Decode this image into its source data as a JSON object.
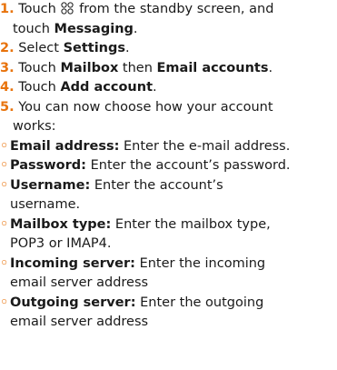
{
  "colors": {
    "accent": "#e8730c",
    "text": "#1a1a1a"
  },
  "steps": [
    {
      "num": "1.",
      "pre": "Touch",
      "icon": "apps-grid-icon",
      "mid": "from the standby screen, and",
      "line2_pre": "touch",
      "line2_bold": "Messaging",
      "line2_post": "."
    },
    {
      "num": "2.",
      "pre": "Select",
      "bold": "Settings",
      "post": "."
    },
    {
      "num": "3.",
      "pre": "Touch",
      "bold": "Mailbox",
      "mid": "then",
      "bold2": "Email accounts",
      "post": "."
    },
    {
      "num": "4.",
      "pre": "Touch",
      "bold": "Add account",
      "post": "."
    },
    {
      "num": "5.",
      "line1": "You can now choose how your account",
      "line2": "works:"
    }
  ],
  "bullets": [
    {
      "mark": "◦",
      "label": "Email address:",
      "text": "Enter the e-mail address."
    },
    {
      "mark": "◦",
      "label": "Password:",
      "text": "Enter the account’s password."
    },
    {
      "mark": "◦",
      "label": "Username:",
      "text": "Enter the account’s",
      "cont": "username."
    },
    {
      "mark": "◦",
      "label": "Mailbox type:",
      "text": "Enter the mailbox type,",
      "cont": "POP3 or IMAP4."
    },
    {
      "mark": "◦",
      "label": "Incoming server:",
      "text": "Enter the incoming",
      "cont": "email server address"
    },
    {
      "mark": "◦",
      "label": "Outgoing server:",
      "text": "Enter the outgoing",
      "cont": "email server address"
    }
  ]
}
